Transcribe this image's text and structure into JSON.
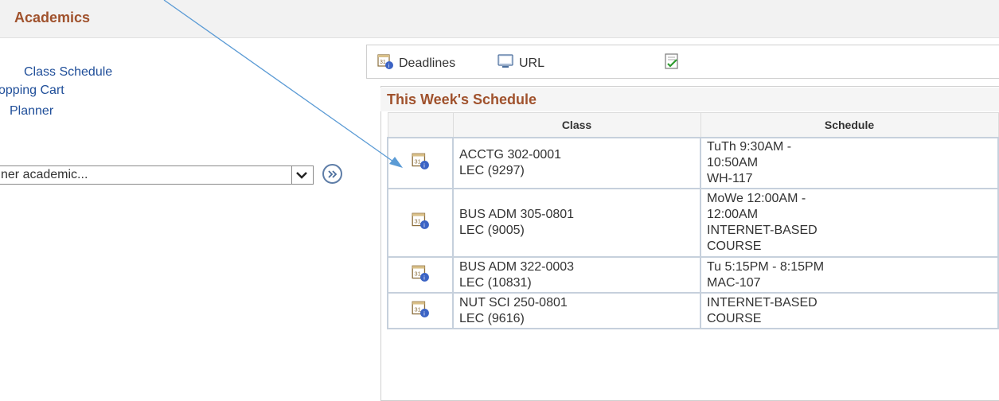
{
  "header": {
    "title": "Academics"
  },
  "sidebar": {
    "links": [
      "Class Schedule",
      "opping Cart",
      "Planner"
    ],
    "dropdown": {
      "selected": "ner academic..."
    }
  },
  "toolbar": {
    "items": [
      {
        "label": "Deadlines",
        "icon": "calendar-info-icon"
      },
      {
        "label": "URL",
        "icon": "url-icon"
      },
      {
        "label": "",
        "icon": "checklist-icon"
      }
    ]
  },
  "schedule": {
    "title": "This Week's Schedule",
    "columns": [
      "",
      "Class",
      "Schedule"
    ],
    "rows": [
      {
        "class": [
          "ACCTG 302-0001",
          "LEC (9297)"
        ],
        "schedule": [
          "TuTh 9:30AM -",
          "10:50AM",
          "WH-117"
        ]
      },
      {
        "class": [
          "BUS ADM 305-0801",
          "LEC (9005)"
        ],
        "schedule": [
          "MoWe 12:00AM -",
          "12:00AM",
          "INTERNET-BASED",
          "COURSE"
        ]
      },
      {
        "class": [
          "BUS ADM 322-0003",
          "LEC (10831)"
        ],
        "schedule": [
          "Tu 5:15PM - 8:15PM",
          "MAC-107"
        ]
      },
      {
        "class": [
          "NUT SCI 250-0801",
          "LEC (9616)"
        ],
        "schedule": [
          "INTERNET-BASED",
          "COURSE"
        ]
      }
    ]
  },
  "colors": {
    "accent": "#a0522d",
    "link": "#1f4e99",
    "arrow": "#5b9bd5"
  }
}
